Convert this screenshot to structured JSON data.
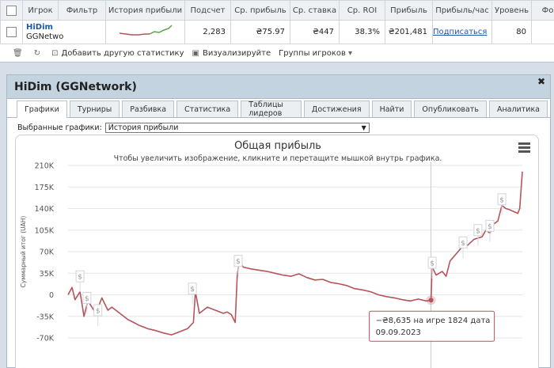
{
  "table": {
    "headers": [
      "Игрок",
      "Фильтр",
      "История прибыли",
      "Подсчет",
      "Ср. прибыль",
      "Ср. ставка",
      "Ср. ROI",
      "Прибыль",
      "Прибыль/час",
      "Уровень",
      "Фо"
    ],
    "row": {
      "player_name": "HiDim",
      "network": "GGNetwo",
      "count": "2,283",
      "avg_profit": "₴75.97",
      "avg_stake": "₴447",
      "avg_roi": "38.3%",
      "profit": "₴201,481",
      "profit_per_hour": "Подписаться",
      "level": "80"
    }
  },
  "toolbar": {
    "add_stat": "Добавить другую статистику",
    "visualize": "Визуализируйте",
    "player_groups": "Группы игроков"
  },
  "dialog": {
    "title": "HiDim (GGNetwork)",
    "tabs": [
      "Графики",
      "Турниры",
      "Разбивка",
      "Статистика",
      "Таблицы лидеров",
      "Достижения",
      "Найти",
      "Опубликовать",
      "Аналитика"
    ],
    "active_tab": "Графики",
    "selector_label": "Выбранные графики:",
    "selector_value": "История прибыли"
  },
  "chart_data": {
    "type": "line",
    "title": "Общая прибыль",
    "subtitle": "Чтобы увеличить изображение, кликните и перетащите мышкой внутрь графика.",
    "ylabel": "Суммарный итог (UAH)",
    "ylim": [
      -70000,
      210000
    ],
    "xlim": [
      0,
      2283
    ],
    "yticks": [
      "210K",
      "175K",
      "140K",
      "105K",
      "70K",
      "35K",
      "0",
      "-35K",
      "-70K"
    ],
    "ytick_values": [
      210000,
      175000,
      140000,
      105000,
      70000,
      35000,
      0,
      -35000,
      -70000
    ],
    "line_color": "#b5545b",
    "marker_label": "$",
    "series": [
      {
        "x": [
          0,
          20,
          35,
          60,
          80,
          100,
          140,
          170,
          200,
          220,
          260,
          300,
          330,
          360,
          400,
          440,
          480,
          520,
          560,
          600,
          630,
          640,
          660,
          700,
          740,
          780,
          800,
          820,
          840,
          850,
          860,
          880,
          920,
          960,
          1000,
          1040,
          1080,
          1120,
          1160,
          1200,
          1240,
          1280,
          1320,
          1360,
          1400,
          1440,
          1480,
          1520,
          1560,
          1600,
          1640,
          1680,
          1720,
          1760,
          1800,
          1824,
          1830,
          1850,
          1880,
          1900,
          1920,
          1960,
          1990,
          2000,
          2040,
          2080,
          2100,
          2120,
          2140,
          2160,
          2180,
          2200,
          2220,
          2240,
          2260,
          2270,
          2283
        ],
        "y": [
          0,
          12000,
          -8000,
          5000,
          -35000,
          -10000,
          -30000,
          -5000,
          -25000,
          -20000,
          -30000,
          -40000,
          -45000,
          -50000,
          -55000,
          -58000,
          -62000,
          -65000,
          -60000,
          -55000,
          -45000,
          5000,
          -30000,
          -20000,
          -25000,
          -30000,
          -28000,
          -32000,
          -45000,
          30000,
          55000,
          45000,
          42000,
          40000,
          38000,
          35000,
          32000,
          30000,
          34000,
          28000,
          24000,
          25000,
          20000,
          18000,
          15000,
          10000,
          8000,
          5000,
          0,
          -3000,
          -5000,
          -8000,
          -10000,
          -7000,
          -10000,
          -8635,
          45000,
          32000,
          38000,
          30000,
          55000,
          70000,
          82000,
          78000,
          90000,
          94000,
          105000,
          100000,
          115000,
          120000,
          145000,
          140000,
          138000,
          135000,
          132000,
          140000,
          200000
        ]
      }
    ],
    "markers": [
      {
        "x": 60,
        "y": 30000
      },
      {
        "x": 95,
        "y": -5000
      },
      {
        "x": 150,
        "y": -25000
      },
      {
        "x": 625,
        "y": 10000
      },
      {
        "x": 855,
        "y": 55000
      },
      {
        "x": 1830,
        "y": 52000
      },
      {
        "x": 1985,
        "y": 85000
      },
      {
        "x": 2060,
        "y": 105000
      },
      {
        "x": 2120,
        "y": 112000
      },
      {
        "x": 2180,
        "y": 155000
      }
    ],
    "tooltip": {
      "x": 1824,
      "y": -8635,
      "value_text": "−₴8,635",
      "game_prefix": "на игре",
      "game_number": "1824",
      "date_label": "дата",
      "date": "09.09.2023"
    }
  }
}
